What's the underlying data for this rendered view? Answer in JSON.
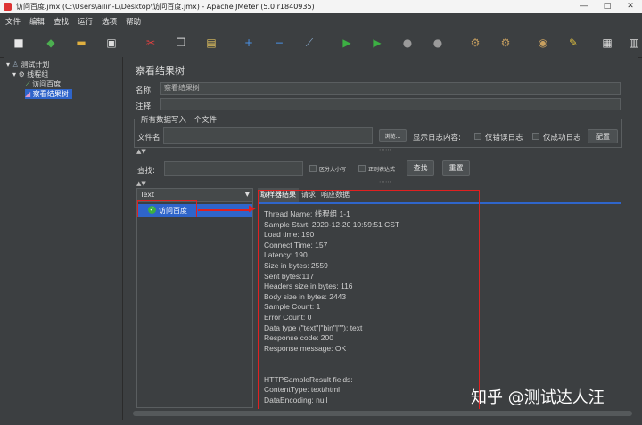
{
  "window": {
    "title": "访问百度.jmx (C:\\Users\\ailin-L\\Desktop\\访问百度.jmx) - Apache JMeter (5.0 r1840935)",
    "controls": [
      "—",
      "□",
      "✕"
    ]
  },
  "menu": [
    "文件",
    "编辑",
    "查找",
    "运行",
    "选项",
    "帮助"
  ],
  "toolbar_icons": [
    {
      "name": "new-icon",
      "color": "#e8e8e8",
      "glyph": "■"
    },
    {
      "name": "templates-icon",
      "color": "#4caf50",
      "glyph": "◆"
    },
    {
      "name": "open-icon",
      "color": "#e0b040",
      "glyph": "▬"
    },
    {
      "name": "save-icon",
      "color": "#dddddd",
      "glyph": "▣"
    },
    {
      "name": "cut-icon",
      "color": "#e04040",
      "glyph": "✂"
    },
    {
      "name": "copy-icon",
      "color": "#dddddd",
      "glyph": "❐"
    },
    {
      "name": "paste-icon",
      "color": "#e0c060",
      "glyph": "▤"
    },
    {
      "name": "expand-icon",
      "color": "#4a90e2",
      "glyph": "+"
    },
    {
      "name": "collapse-icon",
      "color": "#4a90e2",
      "glyph": "−"
    },
    {
      "name": "toggle-icon",
      "color": "#88aacc",
      "glyph": "⟋"
    },
    {
      "name": "start-icon",
      "color": "#3cb043",
      "glyph": "▶"
    },
    {
      "name": "start-no-pause-icon",
      "color": "#3cb043",
      "glyph": "▶"
    },
    {
      "name": "stop-icon",
      "color": "#9a9a9a",
      "glyph": "●"
    },
    {
      "name": "shutdown-icon",
      "color": "#9a9a9a",
      "glyph": "●"
    },
    {
      "name": "clear-icon",
      "color": "#c8a060",
      "glyph": "⚙"
    },
    {
      "name": "clear-all-icon",
      "color": "#c8a060",
      "glyph": "⚙"
    },
    {
      "name": "search-icon",
      "color": "#c8a060",
      "glyph": "◉"
    },
    {
      "name": "reset-search-icon",
      "color": "#e0c040",
      "glyph": "✎"
    },
    {
      "name": "function-helper-icon",
      "color": "#dddddd",
      "glyph": "▦"
    },
    {
      "name": "help-icon",
      "color": "#dddddd",
      "glyph": "▥"
    }
  ],
  "tree": [
    {
      "label": "测试计划",
      "indent": 0,
      "icon": "test-plan-icon",
      "selected": false
    },
    {
      "label": "线程组",
      "indent": 1,
      "icon": "thread-group-icon",
      "selected": false
    },
    {
      "label": "访问百度",
      "indent": 2,
      "icon": "http-sampler-icon",
      "selected": false
    },
    {
      "label": "察看结果树",
      "indent": 2,
      "icon": "listener-icon",
      "selected": true
    }
  ],
  "panel": {
    "title": "察看结果树",
    "name_label": "名称:",
    "name_value": "察看结果树",
    "comment_label": "注释:",
    "group_title": "所有数据写入一个文件",
    "filename_label": "文件名",
    "browse_button": "浏览...",
    "log_label": "显示日志内容:",
    "errors_only": "仅错误日志",
    "success_only": "仅成功日志",
    "configure_button": "配置",
    "search_label": "查找:",
    "case_sensitive": "区分大小写",
    "regex": "正则表达式",
    "search_button": "查找",
    "reset_button": "重置"
  },
  "results": {
    "renderer": "Text",
    "samples": [
      "访问百度"
    ],
    "tabs": [
      "取样器结果",
      "请求",
      "响应数据"
    ],
    "lines": [
      "Thread Name: 线程组 1-1",
      "Sample Start: 2020-12-20 10:59:51 CST",
      "Load time: 190",
      "Connect Time: 157",
      "Latency: 190",
      "Size in bytes: 2559",
      "Sent bytes:117",
      "Headers size in bytes: 116",
      "Body size in bytes: 2443",
      "Sample Count: 1",
      "Error Count: 0",
      "Data type (\"text\"|\"bin\"|\"\"): text",
      "Response code: 200",
      "Response message: OK",
      "",
      "",
      "HTTPSampleResult fields:",
      "ContentType: text/html",
      "DataEncoding: null"
    ]
  },
  "watermark": "知乎 @测试达人汪",
  "colors": {
    "annotation": "#e02020",
    "selection": "#2f65ca",
    "background": "#3c3f41"
  }
}
